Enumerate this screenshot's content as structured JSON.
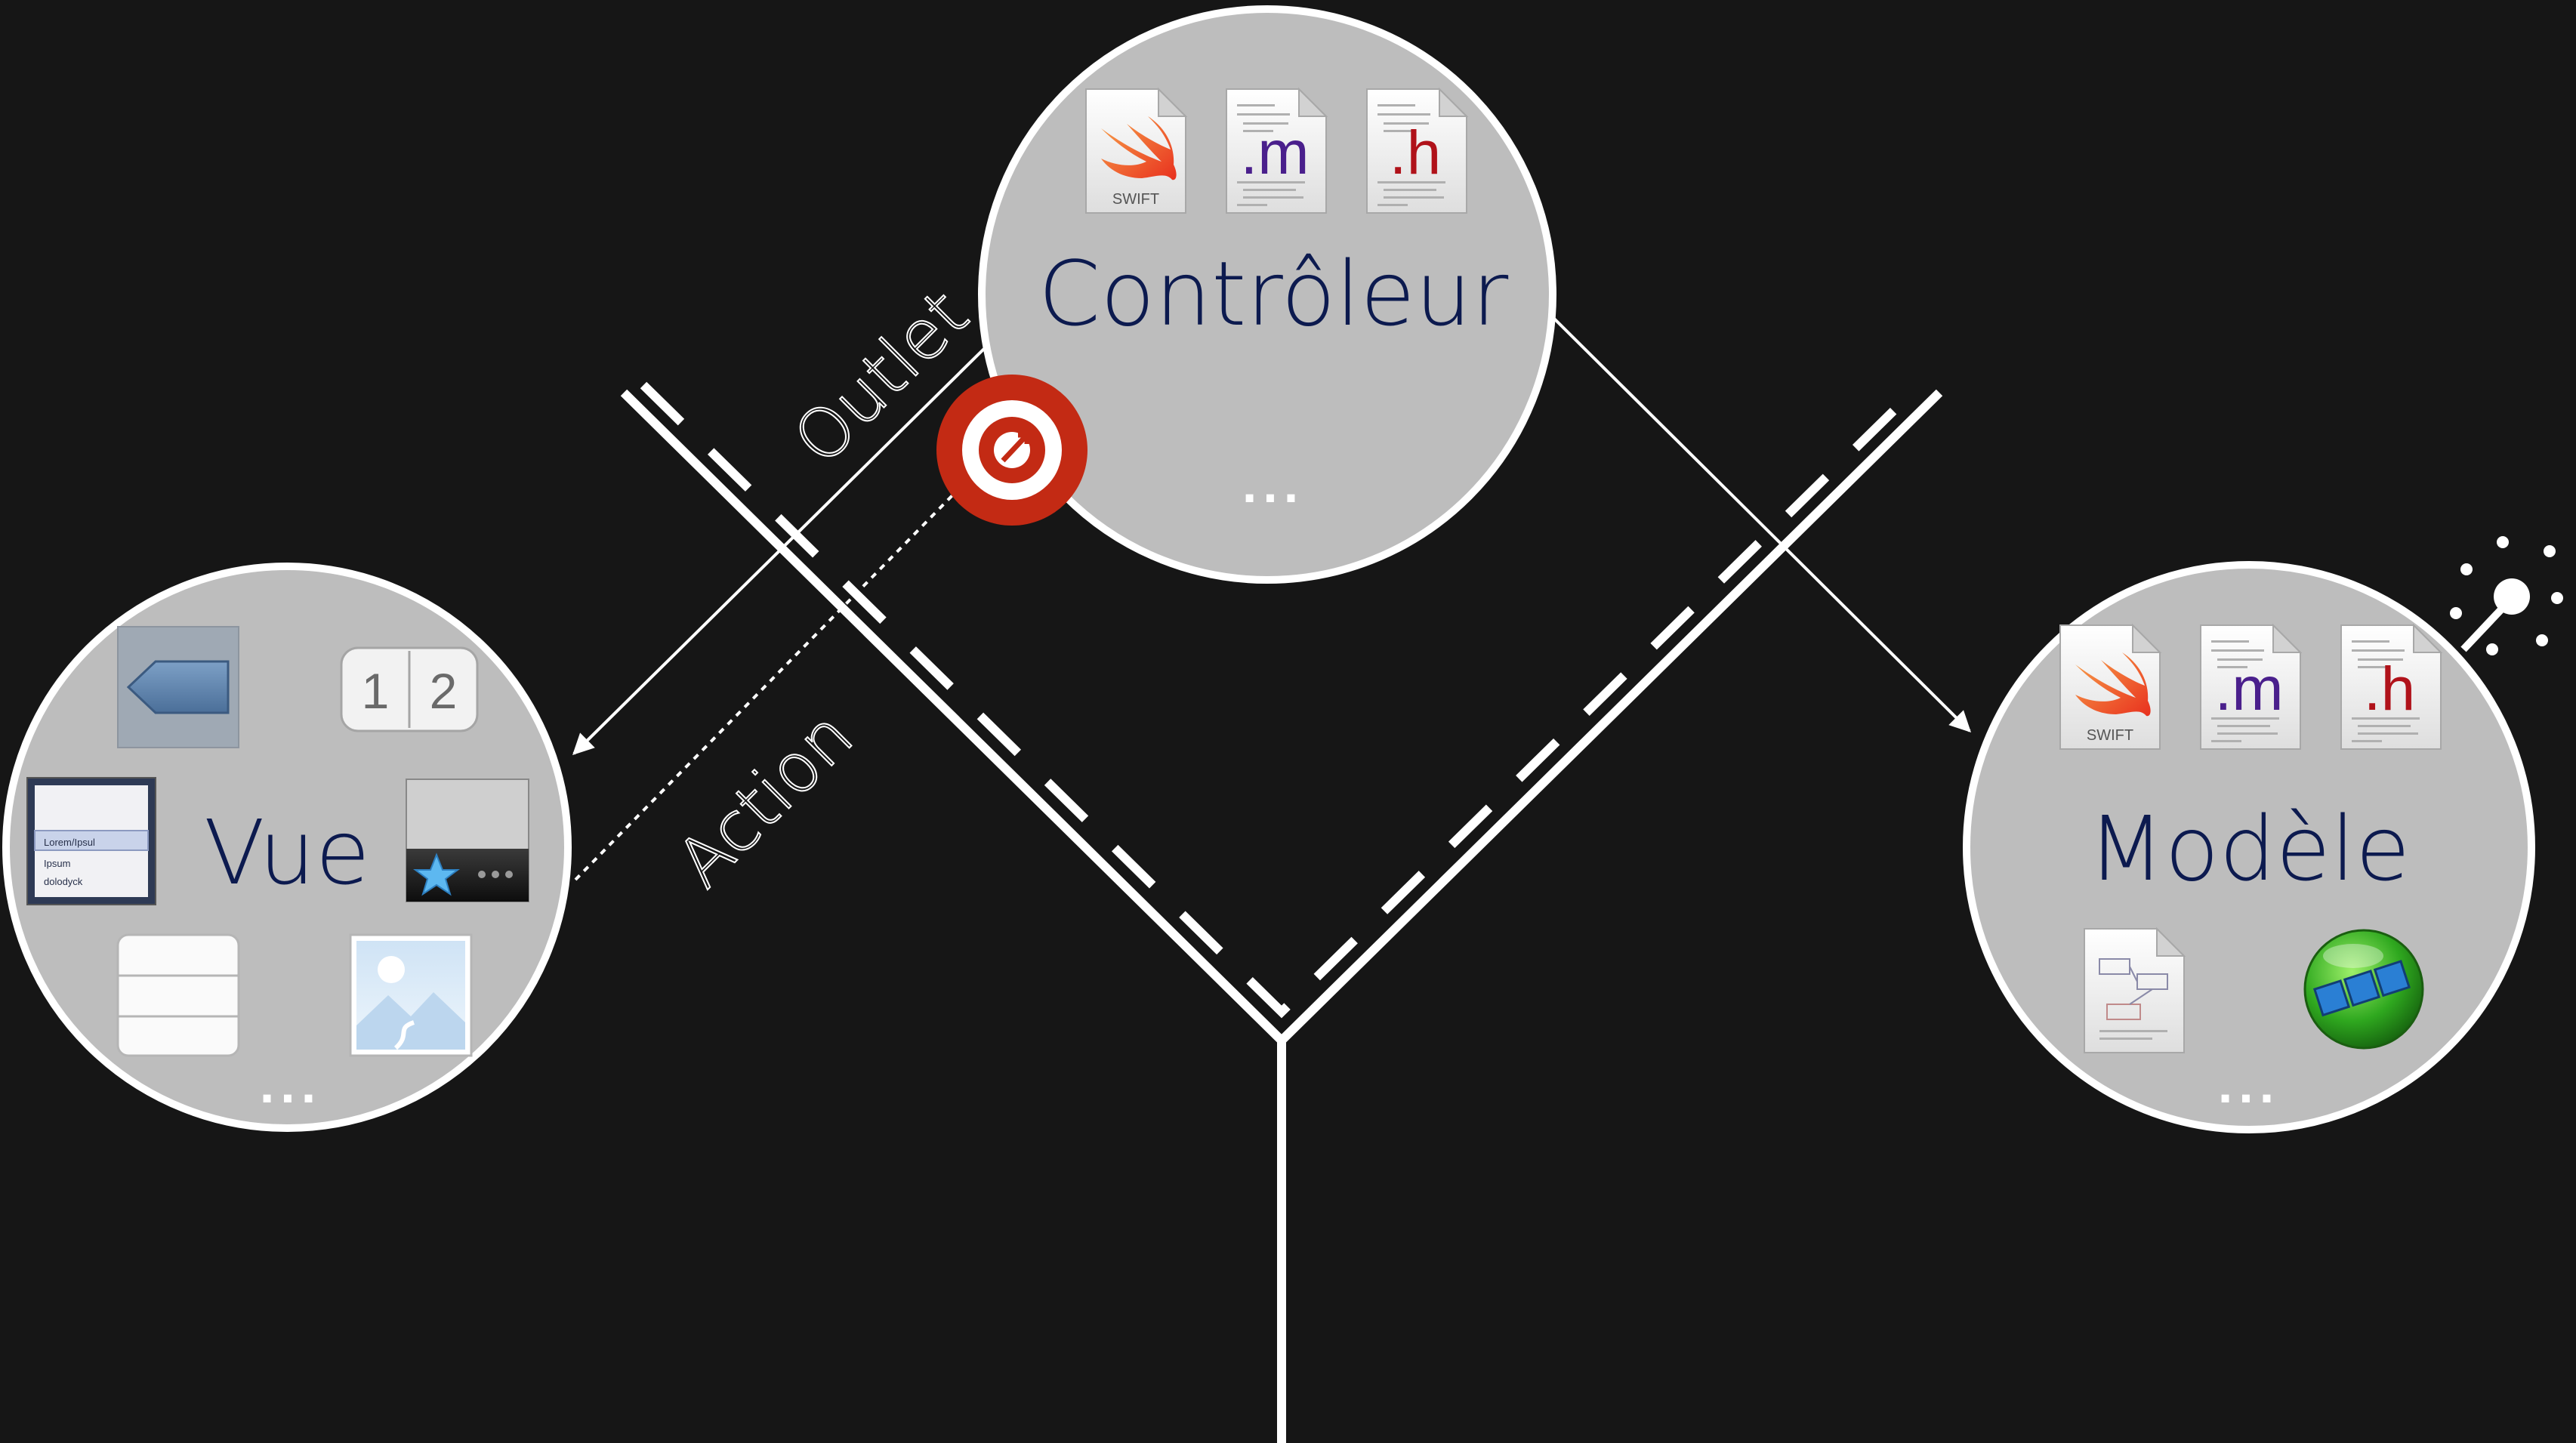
{
  "controller": {
    "label": "Contrôleur",
    "more": "...",
    "files": [
      {
        "icon": "swift-file-icon",
        "text": "SWIFT"
      },
      {
        "icon": "objc-m-file-icon",
        "text": ".m"
      },
      {
        "icon": "objc-h-file-icon",
        "text": ".h"
      }
    ]
  },
  "view": {
    "label": "Vue",
    "more": "...",
    "widgets": [
      {
        "icon": "back-button-icon"
      },
      {
        "icon": "segmented-control-icon",
        "seg1": "1",
        "seg2": "2"
      },
      {
        "icon": "picker-icon",
        "lines": [
          "Lorem/Ipsul",
          "Ipsum",
          "dolodyck"
        ]
      },
      {
        "icon": "tab-bar-icon"
      },
      {
        "icon": "table-view-icon"
      },
      {
        "icon": "image-view-icon"
      }
    ]
  },
  "model": {
    "label": "Modèle",
    "more": "...",
    "files": [
      {
        "icon": "swift-file-icon",
        "text": "SWIFT"
      },
      {
        "icon": "objc-m-file-icon",
        "text": ".m"
      },
      {
        "icon": "objc-h-file-icon",
        "text": ".h"
      },
      {
        "icon": "document-file-icon"
      },
      {
        "icon": "core-data-icon"
      }
    ]
  },
  "links": {
    "outlet": "Outlet",
    "action": "Action"
  },
  "colors": {
    "background": "#161616",
    "circle": "#bdbdbd",
    "label": "#0c1a4f",
    "target": "#c32a14",
    "line": "#ffffff"
  }
}
